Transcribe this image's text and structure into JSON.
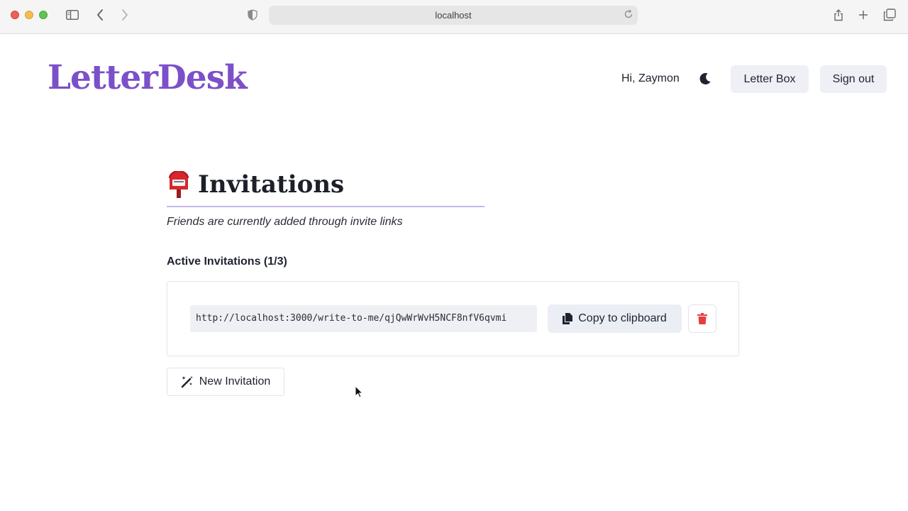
{
  "browser": {
    "url": "localhost"
  },
  "header": {
    "logo": "LetterDesk",
    "greeting": "Hi, Zaymon",
    "letter_box_label": "Letter Box",
    "sign_out_label": "Sign out"
  },
  "main": {
    "title": "Invitations",
    "subtitle": "Friends are currently added through invite links",
    "active_heading": "Active Invitations (1/3)",
    "invitations": [
      {
        "link": "http://localhost:3000/write-to-me/qjQwWrWvH5NCF8nfV6qvmi",
        "copy_label": "Copy to clipboard"
      }
    ],
    "new_invitation_label": "New Invitation"
  },
  "icons": {
    "sidebar": "sidebar-icon",
    "back": "chevron-left-icon",
    "forward": "chevron-right-icon",
    "shield": "shield-icon",
    "reload": "reload-icon",
    "share": "share-icon",
    "new_tab": "plus-icon",
    "tabs": "tabs-overview-icon",
    "theme": "moon-icon",
    "mailbox": "postbox-icon",
    "copy": "copy-icon",
    "delete": "trash-icon",
    "new": "magic-wand-icon"
  },
  "colors": {
    "brand": "#7b50c8",
    "button_bg": "#eceef5",
    "danger": "#e53e3e",
    "rule": "#c7b6ec"
  }
}
